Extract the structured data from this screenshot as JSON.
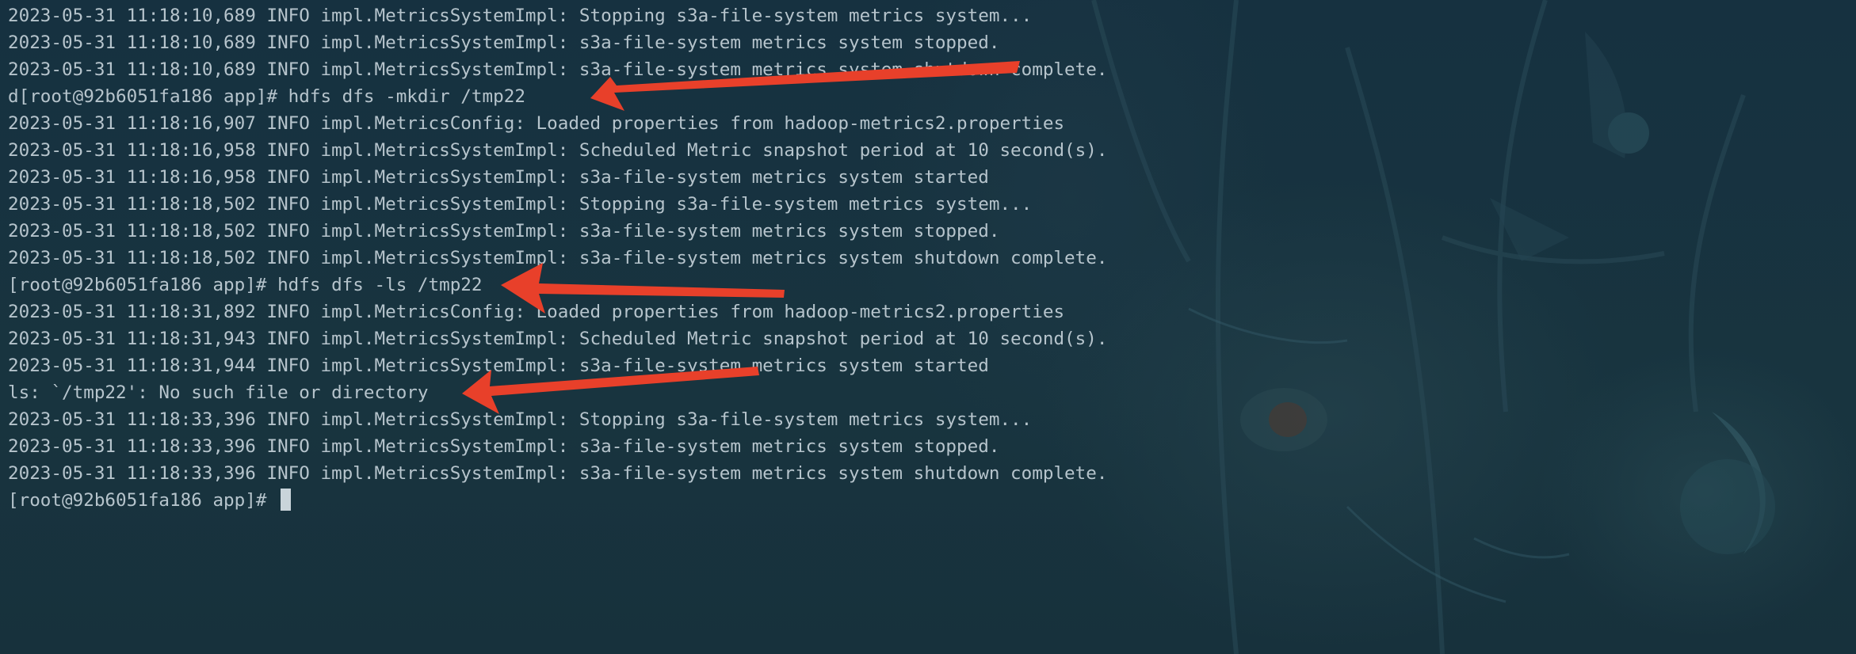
{
  "terminal": {
    "lines": [
      "2023-05-31 11:18:10,689 INFO impl.MetricsSystemImpl: Stopping s3a-file-system metrics system...",
      "2023-05-31 11:18:10,689 INFO impl.MetricsSystemImpl: s3a-file-system metrics system stopped.",
      "2023-05-31 11:18:10,689 INFO impl.MetricsSystemImpl: s3a-file-system metrics system shutdown complete.",
      "d[root@92b6051fa186 app]# hdfs dfs -mkdir /tmp22",
      "2023-05-31 11:18:16,907 INFO impl.MetricsConfig: Loaded properties from hadoop-metrics2.properties",
      "2023-05-31 11:18:16,958 INFO impl.MetricsSystemImpl: Scheduled Metric snapshot period at 10 second(s).",
      "2023-05-31 11:18:16,958 INFO impl.MetricsSystemImpl: s3a-file-system metrics system started",
      "2023-05-31 11:18:18,502 INFO impl.MetricsSystemImpl: Stopping s3a-file-system metrics system...",
      "2023-05-31 11:18:18,502 INFO impl.MetricsSystemImpl: s3a-file-system metrics system stopped.",
      "2023-05-31 11:18:18,502 INFO impl.MetricsSystemImpl: s3a-file-system metrics system shutdown complete.",
      "[root@92b6051fa186 app]# hdfs dfs -ls /tmp22",
      "2023-05-31 11:18:31,892 INFO impl.MetricsConfig: Loaded properties from hadoop-metrics2.properties",
      "2023-05-31 11:18:31,943 INFO impl.MetricsSystemImpl: Scheduled Metric snapshot period at 10 second(s).",
      "2023-05-31 11:18:31,944 INFO impl.MetricsSystemImpl: s3a-file-system metrics system started",
      "ls: `/tmp22': No such file or directory",
      "2023-05-31 11:18:33,396 INFO impl.MetricsSystemImpl: Stopping s3a-file-system metrics system...",
      "2023-05-31 11:18:33,396 INFO impl.MetricsSystemImpl: s3a-file-system metrics system stopped.",
      "2023-05-31 11:18:33,396 INFO impl.MetricsSystemImpl: s3a-file-system metrics system shutdown complete."
    ],
    "prompt": "[root@92b6051fa186 app]# "
  },
  "colors": {
    "background": "#17323f",
    "text": "#b6c4cc",
    "cursor": "#c9d4da",
    "annotation_arrow": "#e8402a"
  }
}
